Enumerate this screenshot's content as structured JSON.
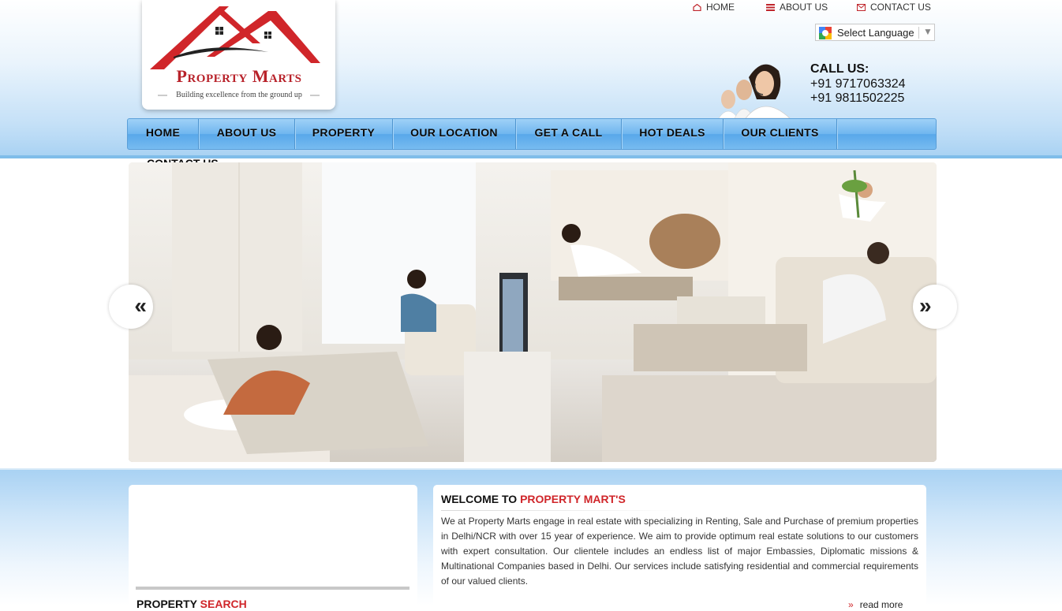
{
  "brand": {
    "name": "Property Marts",
    "tagline": "Building excellence from the ground up",
    "primary_color": "#b8222a",
    "accent_blue": "#6fb6ef"
  },
  "top_links": [
    {
      "label": "HOME",
      "icon": "home-icon"
    },
    {
      "label": "ABOUT US",
      "icon": "list-icon"
    },
    {
      "label": "CONTACT US",
      "icon": "envelope-icon"
    }
  ],
  "language": {
    "label": "Select Language",
    "icon": "google-translate-icon"
  },
  "call": {
    "title": "CALL US:",
    "numbers": [
      "+91 9717063324",
      "+91 9811502225"
    ]
  },
  "nav": {
    "items": [
      "HOME",
      "ABOUT US",
      "PROPERTY",
      "OUR LOCATION",
      "GET A CALL",
      "HOT DEALS",
      "OUR CLIENTS",
      "CONTACT US"
    ]
  },
  "slider": {
    "prev": "«",
    "next": "»"
  },
  "search": {
    "title_a": "PROPERTY",
    "title_b": "SEARCH"
  },
  "welcome": {
    "title_a": "WELCOME TO",
    "title_b": "PROPERTY MART'S",
    "body": "We at Property Marts engage in real estate with specializing in Renting, Sale and Purchase of premium properties in Delhi/NCR with over 15 year of experience. We aim to provide optimum real estate solutions to our customers with expert consultation. Our clientele includes an endless list of major Embassies, Diplomatic missions & Multinational Companies based in Delhi. Our services include satisfying residential and commercial requirements of our valued clients.",
    "read_more": "read more"
  }
}
